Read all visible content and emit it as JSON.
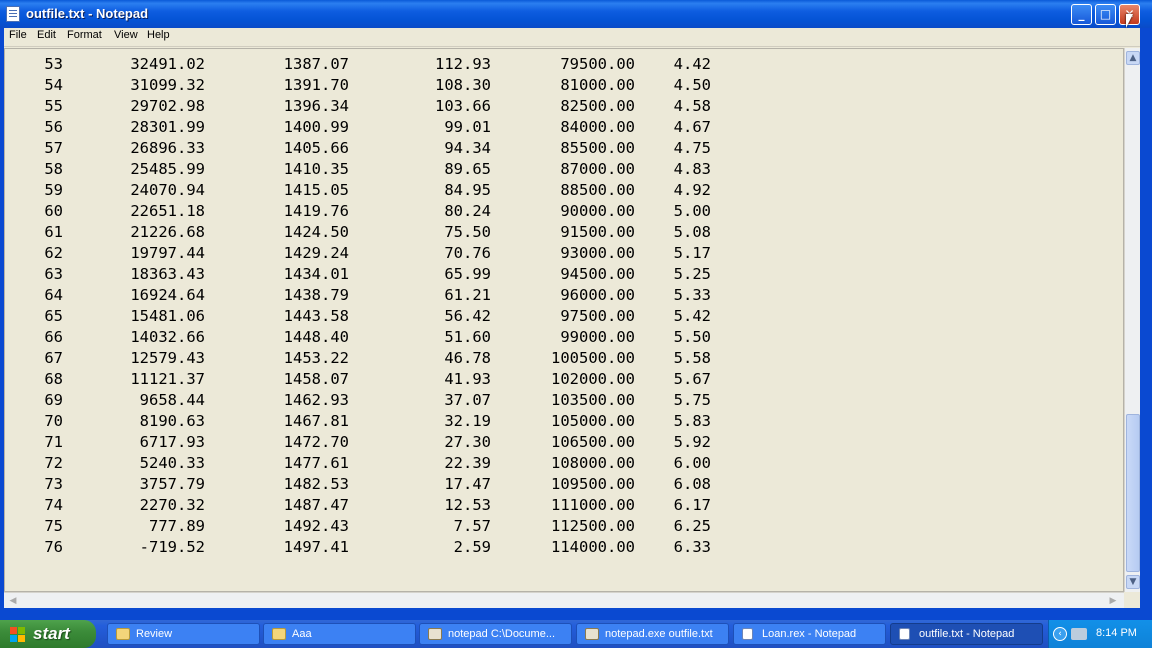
{
  "window": {
    "title": "outfile.txt - Notepad",
    "buttons": {
      "minimize": "_",
      "maximize": "□",
      "close": "✕"
    }
  },
  "menu": [
    "File",
    "Edit",
    "Format",
    "View",
    "Help"
  ],
  "rows": [
    [
      "53",
      "32491.02",
      "1387.07",
      "112.93",
      "79500.00",
      "4.42"
    ],
    [
      "54",
      "31099.32",
      "1391.70",
      "108.30",
      "81000.00",
      "4.50"
    ],
    [
      "55",
      "29702.98",
      "1396.34",
      "103.66",
      "82500.00",
      "4.58"
    ],
    [
      "56",
      "28301.99",
      "1400.99",
      "99.01",
      "84000.00",
      "4.67"
    ],
    [
      "57",
      "26896.33",
      "1405.66",
      "94.34",
      "85500.00",
      "4.75"
    ],
    [
      "58",
      "25485.99",
      "1410.35",
      "89.65",
      "87000.00",
      "4.83"
    ],
    [
      "59",
      "24070.94",
      "1415.05",
      "84.95",
      "88500.00",
      "4.92"
    ],
    [
      "60",
      "22651.18",
      "1419.76",
      "80.24",
      "90000.00",
      "5.00"
    ],
    [
      "61",
      "21226.68",
      "1424.50",
      "75.50",
      "91500.00",
      "5.08"
    ],
    [
      "62",
      "19797.44",
      "1429.24",
      "70.76",
      "93000.00",
      "5.17"
    ],
    [
      "63",
      "18363.43",
      "1434.01",
      "65.99",
      "94500.00",
      "5.25"
    ],
    [
      "64",
      "16924.64",
      "1438.79",
      "61.21",
      "96000.00",
      "5.33"
    ],
    [
      "65",
      "15481.06",
      "1443.58",
      "56.42",
      "97500.00",
      "5.42"
    ],
    [
      "66",
      "14032.66",
      "1448.40",
      "51.60",
      "99000.00",
      "5.50"
    ],
    [
      "67",
      "12579.43",
      "1453.22",
      "46.78",
      "100500.00",
      "5.58"
    ],
    [
      "68",
      "11121.37",
      "1458.07",
      "41.93",
      "102000.00",
      "5.67"
    ],
    [
      "69",
      "9658.44",
      "1462.93",
      "37.07",
      "103500.00",
      "5.75"
    ],
    [
      "70",
      "8190.63",
      "1467.81",
      "32.19",
      "105000.00",
      "5.83"
    ],
    [
      "71",
      "6717.93",
      "1472.70",
      "27.30",
      "106500.00",
      "5.92"
    ],
    [
      "72",
      "5240.33",
      "1477.61",
      "22.39",
      "108000.00",
      "6.00"
    ],
    [
      "73",
      "3757.79",
      "1482.53",
      "17.47",
      "109500.00",
      "6.08"
    ],
    [
      "74",
      "2270.32",
      "1487.47",
      "12.53",
      "111000.00",
      "6.17"
    ],
    [
      "75",
      "777.89",
      "1492.43",
      "7.57",
      "112500.00",
      "6.25"
    ],
    [
      "76",
      "-719.52",
      "1497.41",
      "2.59",
      "114000.00",
      "6.33"
    ]
  ],
  "taskbar": {
    "start_label": "start",
    "tasks": [
      {
        "label": "Review",
        "icon": "folder-icon",
        "active": false
      },
      {
        "label": "Aaa",
        "icon": "folder-icon",
        "active": false
      },
      {
        "label": "notepad C:\\Docume...",
        "icon": "batch-file-icon",
        "active": false
      },
      {
        "label": "notepad.exe outfile.txt",
        "icon": "batch-file-icon",
        "active": false
      },
      {
        "label": "Loan.rex - Notepad",
        "icon": "notepad-icon",
        "active": false
      },
      {
        "label": "outfile.txt - Notepad",
        "icon": "notepad-icon",
        "active": true
      }
    ],
    "clock": "8:14 PM"
  },
  "colors": {
    "titlebar": "#0a5ad8",
    "close_button": "#c3391d",
    "editor_background": "#ece9d8",
    "taskbar": "#245edb",
    "start_button": "#3c8c3a",
    "tray": "#0f82d8"
  }
}
